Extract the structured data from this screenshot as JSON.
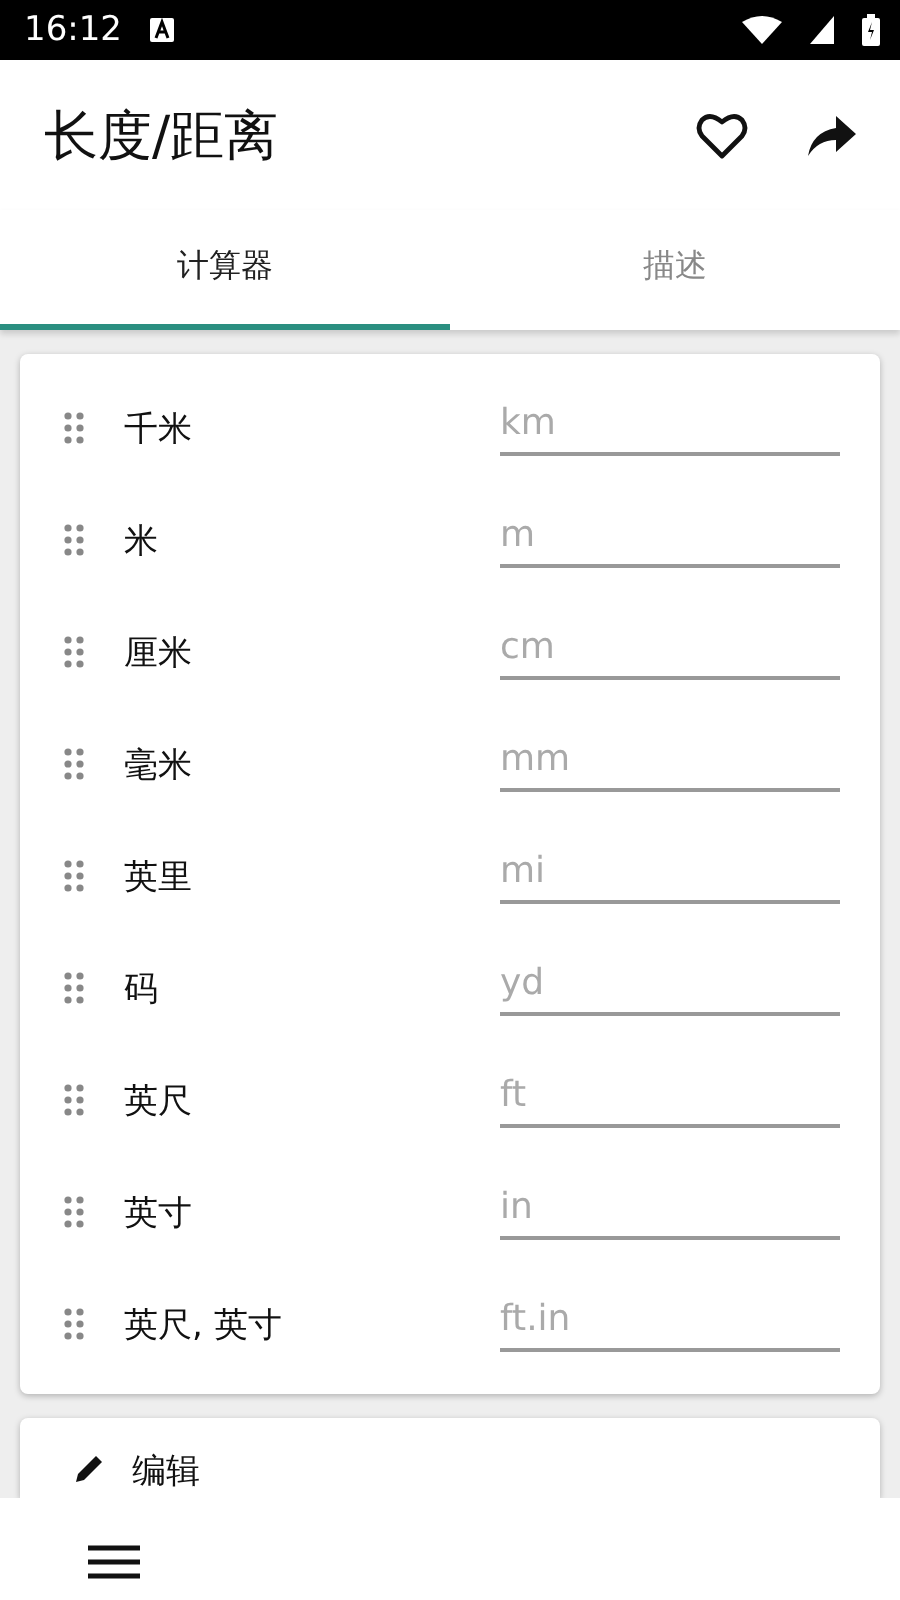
{
  "status_bar": {
    "time": "16:12"
  },
  "app_bar": {
    "title": "长度/距离"
  },
  "tabs": [
    {
      "label": "计算器",
      "selected": true
    },
    {
      "label": "描述",
      "selected": false
    }
  ],
  "units": [
    {
      "name": "千米",
      "placeholder": "km"
    },
    {
      "name": "米",
      "placeholder": "m"
    },
    {
      "name": "厘米",
      "placeholder": "cm"
    },
    {
      "name": "毫米",
      "placeholder": "mm"
    },
    {
      "name": "英里",
      "placeholder": "mi"
    },
    {
      "name": "码",
      "placeholder": "yd"
    },
    {
      "name": "英尺",
      "placeholder": "ft"
    },
    {
      "name": "英寸",
      "placeholder": "in"
    },
    {
      "name": "英尺, 英寸",
      "placeholder": "ft.in"
    }
  ],
  "edit_card": {
    "label": "编辑"
  }
}
